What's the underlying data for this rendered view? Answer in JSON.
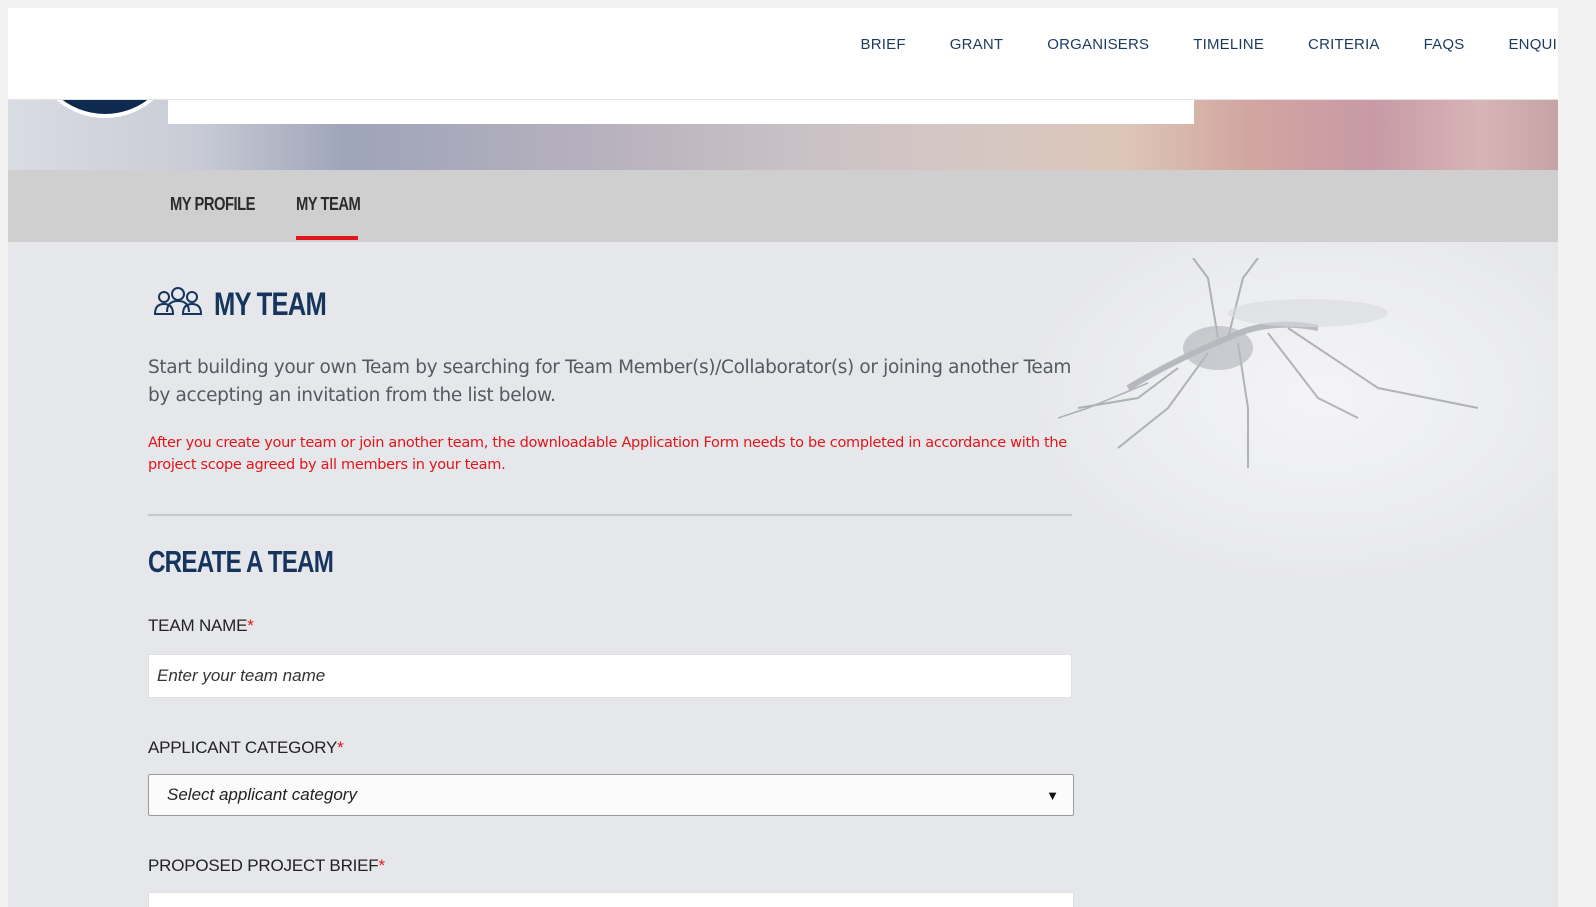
{
  "nav": {
    "links": [
      "BRIEF",
      "GRANT",
      "ORGANISERS",
      "TIMELINE",
      "CRITERIA",
      "FAQS",
      "ENQUIR"
    ]
  },
  "tabs": {
    "profile": "MY PROFILE",
    "team": "MY TEAM"
  },
  "page": {
    "title": "MY TEAM",
    "intro": "Start building your own Team by searching for Team Member(s)/Collaborator(s) or joining another Team by accepting an invitation from the list below.",
    "note": "After you create your team or join another team, the downloadable Application Form needs to be completed in accordance with the project scope agreed by all members in your team."
  },
  "form": {
    "section_title": "CREATE A TEAM",
    "team_name_label": "TEAM NAME",
    "team_name_placeholder": "Enter your team name",
    "category_label": "APPLICANT CATEGORY",
    "category_value": "Select applicant category",
    "brief_label": "PROPOSED PROJECT BRIEF",
    "required_mark": "*"
  },
  "colors": {
    "brand_navy": "#15355e",
    "accent_red": "#e0161b"
  },
  "icons": {
    "team": "team-icon",
    "dropdown": "caret-down-icon"
  }
}
